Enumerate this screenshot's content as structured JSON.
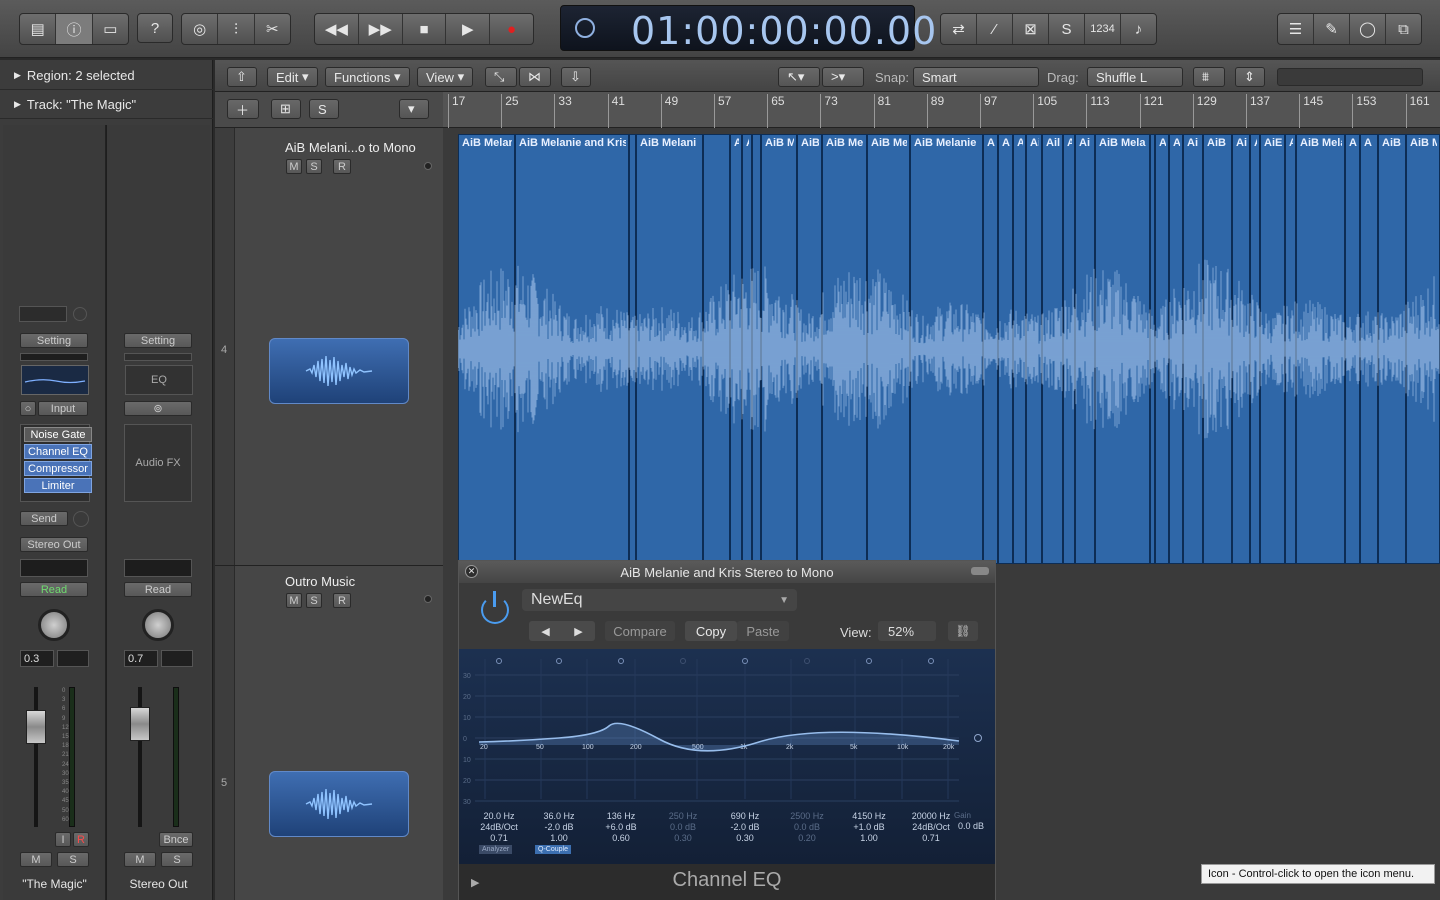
{
  "lcd": {
    "time": "01:00:00:00.00"
  },
  "toolbar": {
    "tuner_label": "♪",
    "cycle_label": "1234"
  },
  "inspector": {
    "region_label": "Region: 2 selected",
    "track_label": "Track:  \"The Magic\""
  },
  "strip1": {
    "setting": "Setting",
    "input": "Input",
    "plugins": [
      "Noise Gate",
      "Channel EQ",
      "Compressor",
      "Limiter"
    ],
    "send": "Send",
    "output": "Stereo Out",
    "automation": "Read",
    "value": "0.3",
    "i_label": "I",
    "r_label": "R",
    "m_label": "M",
    "s_label": "S",
    "name": "\"The Magic\""
  },
  "strip2": {
    "setting": "Setting",
    "eq": "EQ",
    "audio_fx": "Audio FX",
    "automation": "Read",
    "value": "0.7",
    "bnce": "Bnce",
    "m_label": "M",
    "s_label": "S",
    "name": "Stereo Out"
  },
  "meter_scale": [
    "0",
    "3",
    "6",
    "9",
    "12",
    "15",
    "18",
    "21",
    "24",
    "30",
    "35",
    "40",
    "45",
    "50",
    "60"
  ],
  "tracks_toolbar": {
    "edit": "Edit",
    "functions": "Functions",
    "view": "View",
    "snap_label": "Snap:",
    "snap_value": "Smart",
    "drag_label": "Drag:",
    "drag_value": "Shuffle L"
  },
  "track_header": {
    "s_label": "S"
  },
  "ruler": [
    "17",
    "25",
    "33",
    "41",
    "49",
    "57",
    "65",
    "73",
    "81",
    "89",
    "97",
    "105",
    "113",
    "121",
    "129",
    "137",
    "145",
    "153",
    "161"
  ],
  "tracks": [
    {
      "number": "4",
      "name": "AiB Melani...o to Mono",
      "m": "M",
      "s": "S",
      "r": "R"
    },
    {
      "number": "5",
      "name": "Outro Music",
      "m": "M",
      "s": "S",
      "r": "R"
    }
  ],
  "regions": [
    "AiB Melar",
    "AiB Melanie and Kris",
    "",
    "AiB Melani",
    "",
    "Ail",
    "A",
    "",
    "AiB M",
    "AiB",
    "AiB Me",
    "AiB Me",
    "AiB Melanie",
    "A",
    "A",
    "A",
    "Ai",
    "Ail",
    "A",
    "Ai",
    "AiB Mela",
    "",
    "A",
    "A",
    "Ai",
    "AiB I",
    "Ai",
    "A",
    "AiE",
    "A",
    "AiB Mela",
    "A",
    "A",
    "AiB",
    "AiB M"
  ],
  "eq": {
    "title": "AiB Melanie and Kris Stereo to Mono",
    "preset": "NewEq",
    "compare": "Compare",
    "copy": "Copy",
    "paste": "Paste",
    "view_label": "View:",
    "view_value": "52%",
    "footer": "Channel EQ",
    "db_scale": [
      "30",
      "20",
      "10",
      "0",
      "10",
      "20",
      "30"
    ],
    "freq_scale": [
      "20",
      "50",
      "100",
      "200",
      "500",
      "1k",
      "2k",
      "5k",
      "10k",
      "20k"
    ],
    "bands": [
      {
        "freq": "20.0 Hz",
        "gain": "24dB/Oct",
        "q": "0.71",
        "active": true
      },
      {
        "freq": "36.0 Hz",
        "gain": "-2.0 dB",
        "q": "1.00",
        "active": true
      },
      {
        "freq": "136 Hz",
        "gain": "+6.0 dB",
        "q": "0.60",
        "active": true
      },
      {
        "freq": "250 Hz",
        "gain": "0.0 dB",
        "q": "0.30",
        "active": false
      },
      {
        "freq": "690 Hz",
        "gain": "-2.0 dB",
        "q": "0.30",
        "active": true
      },
      {
        "freq": "2500 Hz",
        "gain": "0.0 dB",
        "q": "0.20",
        "active": false
      },
      {
        "freq": "4150 Hz",
        "gain": "+1.0 dB",
        "q": "1.00",
        "active": true
      },
      {
        "freq": "20000 Hz",
        "gain": "24dB/Oct",
        "q": "0.71",
        "active": true
      }
    ],
    "gain_label": "Gain",
    "gain_value": "0.0 dB",
    "analyzer": "Analyzer",
    "qcouple": "Q-Couple"
  },
  "tooltip": "Icon - Control-click to open the icon menu."
}
